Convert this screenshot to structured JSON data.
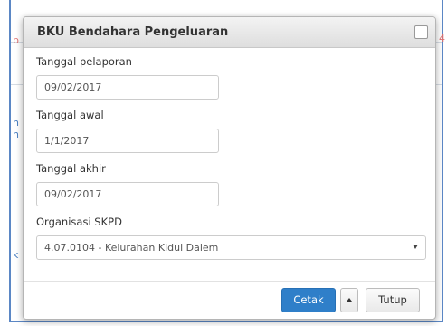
{
  "modal": {
    "title": "BKU Bendahara Pengeluaran",
    "fields": {
      "tanggal_pelaporan": {
        "label": "Tanggal pelaporan",
        "value": "09/02/2017"
      },
      "tanggal_awal": {
        "label": "Tanggal awal",
        "value": "1/1/2017"
      },
      "tanggal_akhir": {
        "label": "Tanggal akhir",
        "value": "09/02/2017"
      },
      "organisasi": {
        "label": "Organisasi SKPD",
        "selected": "4.07.0104 - Kelurahan Kidul Dalem"
      }
    },
    "buttons": {
      "cetak": "Cetak",
      "tutup": "Tutup"
    }
  },
  "background": {
    "fragments": {
      "left_top": "p",
      "right_top": "4",
      "left_mid1": "n",
      "left_mid2": "n",
      "left_low": "k"
    }
  },
  "colors": {
    "primary_button": "#2f7fc9",
    "frame_border": "#5b87c5"
  }
}
